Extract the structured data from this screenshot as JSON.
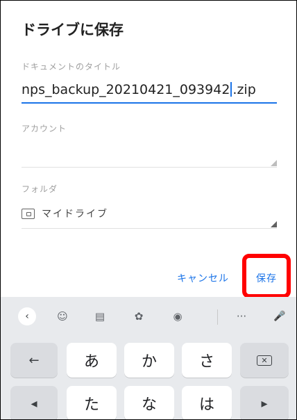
{
  "dialog": {
    "title": "ドライブに保存",
    "doc_title_label": "ドキュメントのタイトル",
    "doc_title_before_cursor": "nps_backup_20210421_093942",
    "doc_title_after_cursor": ".zip",
    "account_label": "アカウント",
    "account_value": "",
    "folder_label": "フォルダ",
    "folder_icon": "drive-folder-icon",
    "folder_value": "マイドライブ",
    "cancel_label": "キャンセル",
    "save_label": "保存"
  },
  "keyboard": {
    "toolbar": {
      "back": "‹",
      "sticker": "☺",
      "clipboard": "▤",
      "settings": "✿",
      "theme": "◉",
      "more": "···",
      "mic": "🎤"
    },
    "row1": [
      "←",
      "あ",
      "か",
      "さ",
      "⌫"
    ],
    "row2": [
      "◂",
      "た",
      "な",
      "は",
      "▸"
    ]
  },
  "colors": {
    "accent": "#1a73e8",
    "highlight": "#ff0000",
    "keyboard_bg": "#e8eaed"
  }
}
